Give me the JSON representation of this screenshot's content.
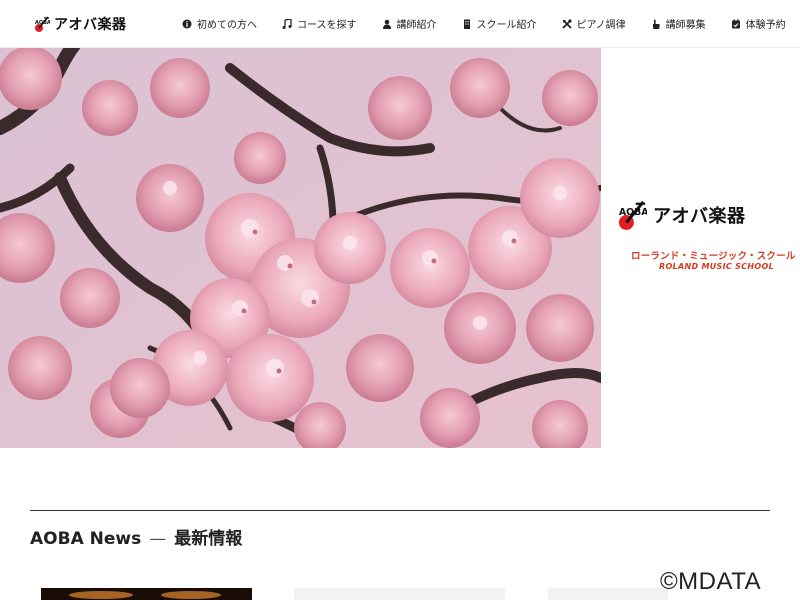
{
  "header": {
    "logo_text": "アオバ楽器",
    "nav": [
      {
        "label": "初めての方へ",
        "icon": "info-circle-icon"
      },
      {
        "label": "コースを探す",
        "icon": "music-note-icon"
      },
      {
        "label": "講師紹介",
        "icon": "person-icon"
      },
      {
        "label": "スクール紹介",
        "icon": "building-icon"
      },
      {
        "label": "ピアノ調律",
        "icon": "tools-icon"
      },
      {
        "label": "講師募集",
        "icon": "hand-pointer-icon"
      },
      {
        "label": "体験予約",
        "icon": "calendar-check-icon"
      }
    ]
  },
  "hero": {
    "side_logo_text": "アオバ楽器",
    "side_sub_jp": "ローランド・ミュージック・スクール",
    "side_sub_en": "ROLAND MUSIC SCHOOL"
  },
  "news": {
    "title_en": "AOBA News",
    "dash": "—",
    "title_jp": "最新情報"
  },
  "watermark": "©MDATA",
  "colors": {
    "accent_red": "#d43a1e",
    "rule": "#333333"
  }
}
